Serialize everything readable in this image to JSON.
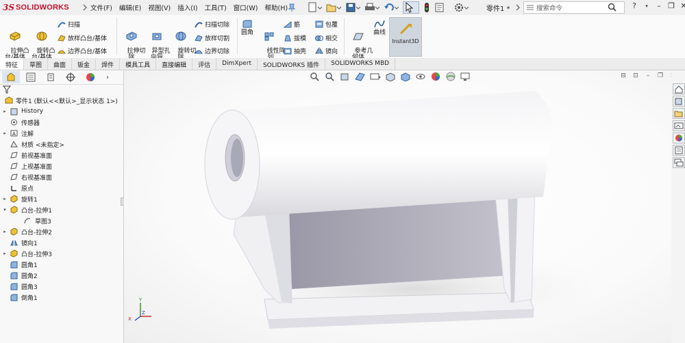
{
  "app": {
    "logo_ds": "3S",
    "logo_text": "SOLIDWORKS",
    "doc_name": "零件1 *"
  },
  "menu": [
    "文件(F)",
    "编辑(E)",
    "视图(V)",
    "插入(I)",
    "工具(T)",
    "窗口(W)",
    "帮助(H)"
  ],
  "search": {
    "placeholder": "搜索命令"
  },
  "ribbon": {
    "extrude_boss": "拉伸凸\n台/基体",
    "revolve_boss": "旋转凸\n台/基体",
    "sweep": "扫描",
    "loft_boss": "放样凸台/基体",
    "boundary_boss": "边界凸台/基体",
    "extrude_cut": "拉伸切\n除",
    "hole_wizard": "异型孔\n向导",
    "revolve_cut": "旋转切\n除",
    "sweep_cut": "扫描切除",
    "loft_cut": "放样切割",
    "boundary_cut": "边界切除",
    "fillet": "圆角",
    "linear_pattern": "线性阵\n列",
    "rib": "筋",
    "draft": "拔模",
    "shell": "抽壳",
    "wrap": "包覆",
    "intersect": "相交",
    "mirror": "镜向",
    "ref_geometry": "参考几\n何体",
    "curves": "曲线",
    "instant3d": "Instant3D"
  },
  "command_tabs": [
    "特征",
    "草图",
    "曲面",
    "钣金",
    "焊件",
    "模具工具",
    "直接编辑",
    "评估",
    "DimXpert",
    "SOLIDWORKS 插件",
    "SOLIDWORKS MBD"
  ],
  "tree": {
    "root": "零件1 (默认<<默认>_显示状态 1>)",
    "items": [
      {
        "label": "History",
        "exp": "▸"
      },
      {
        "label": "传感器",
        "exp": ""
      },
      {
        "label": "注解",
        "exp": "▸"
      },
      {
        "label": "材质 <未指定>",
        "exp": ""
      },
      {
        "label": "前视基准面",
        "exp": ""
      },
      {
        "label": "上视基准面",
        "exp": ""
      },
      {
        "label": "右视基准面",
        "exp": ""
      },
      {
        "label": "原点",
        "exp": ""
      },
      {
        "label": "旋转1",
        "exp": "▸"
      },
      {
        "label": "凸台-拉伸1",
        "exp": "▾"
      },
      {
        "label": "草图3",
        "exp": ""
      },
      {
        "label": "凸台-拉伸2",
        "exp": "▸"
      },
      {
        "label": "镜向1",
        "exp": ""
      },
      {
        "label": "凸台-拉伸3",
        "exp": "▸"
      },
      {
        "label": "圆角1",
        "exp": ""
      },
      {
        "label": "圆角2",
        "exp": ""
      },
      {
        "label": "圆角3",
        "exp": ""
      },
      {
        "label": "倒角1",
        "exp": ""
      }
    ]
  },
  "triad": {
    "x": "X",
    "y": "Y",
    "z": "Z"
  },
  "colors": {
    "accent": "#c8102e",
    "ribbon_active": "#cfd6dd",
    "model": "#e6e6ea"
  }
}
